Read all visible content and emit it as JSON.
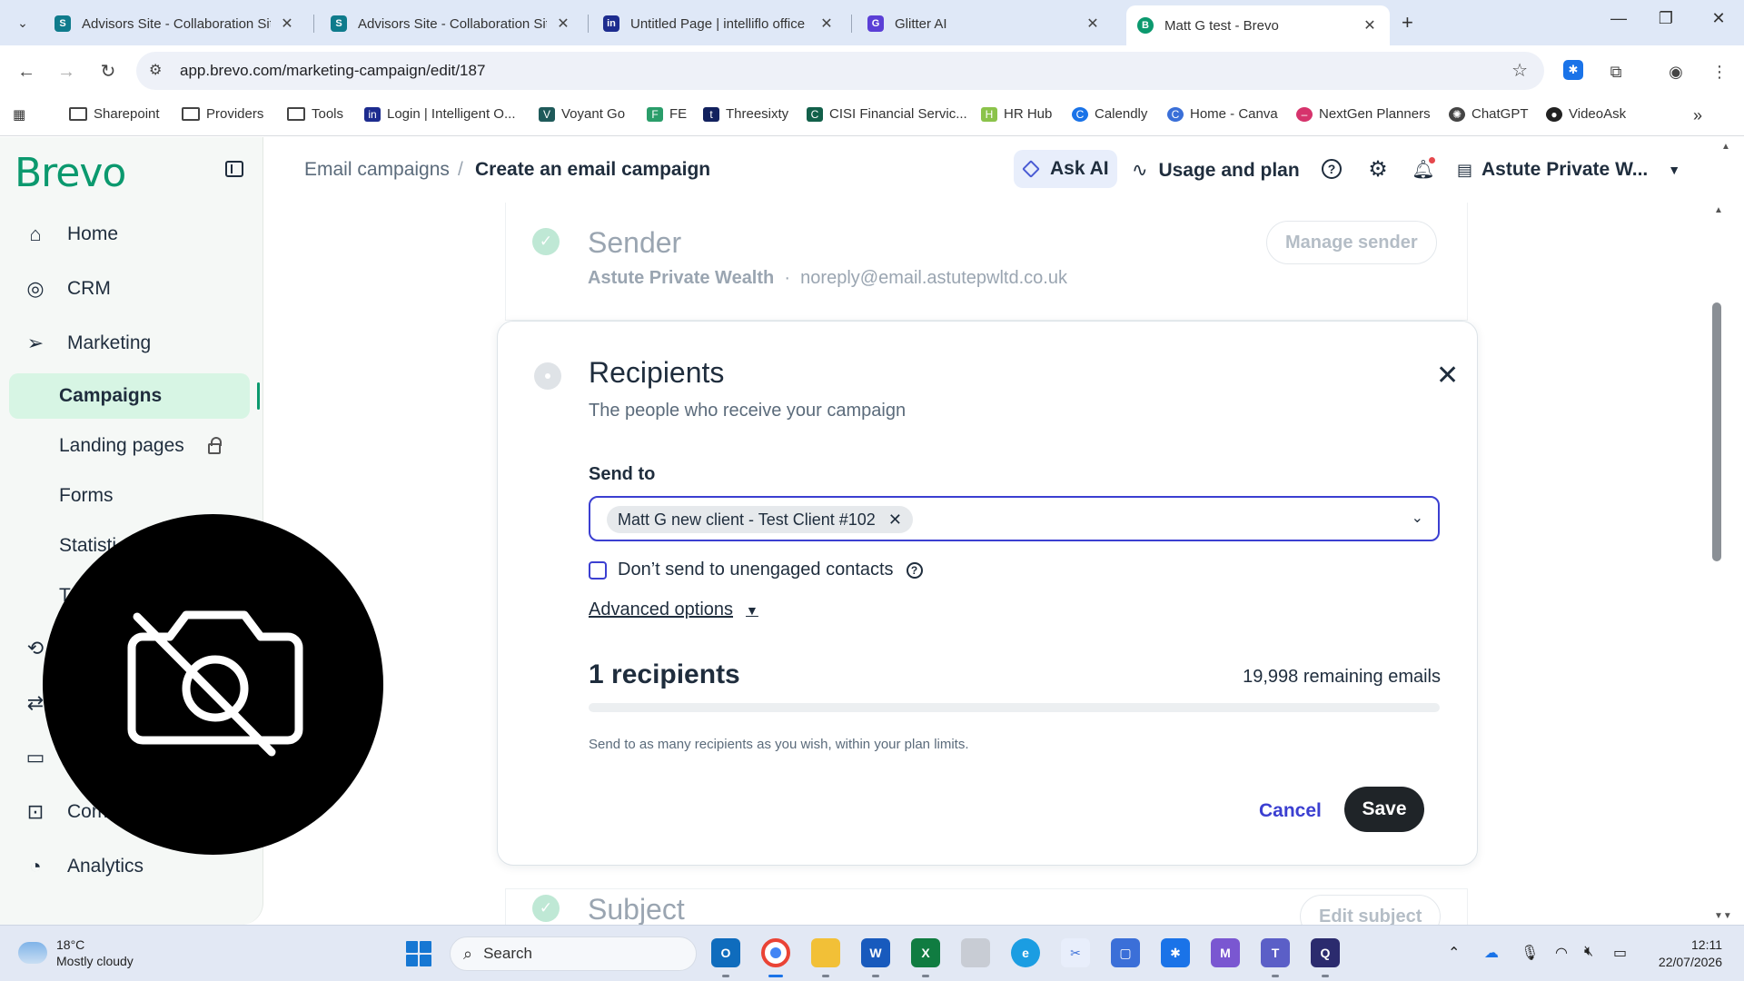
{
  "browser": {
    "tabs": [
      {
        "title": "Advisors Site - Collaboration Sit",
        "favicon": "sharepoint-icon"
      },
      {
        "title": "Advisors Site - Collaboration Sit",
        "favicon": "sharepoint-icon"
      },
      {
        "title": "Untitled Page | intelliflo office",
        "favicon": "intelliflo-icon"
      },
      {
        "title": "Glitter AI",
        "favicon": "glitter-icon"
      },
      {
        "title": "Matt G test - Brevo",
        "favicon": "brevo-icon",
        "active": true
      }
    ],
    "url": "app.brevo.com/marketing-campaign/edit/187",
    "bookmarks": [
      "Sharepoint",
      "Providers",
      "Tools",
      "Login | Intelligent O...",
      "Voyant Go",
      "FE",
      "Threesixty",
      "CISI Financial Servic...",
      "HR Hub",
      "Calendly",
      "Home - Canva",
      "NextGen Planners",
      "ChatGPT",
      "VideoAsk"
    ]
  },
  "app": {
    "logo": "Brevo",
    "nav": {
      "home": "Home",
      "crm": "CRM",
      "marketing": "Marketing",
      "campaigns": "Campaigns",
      "landing_pages": "Landing pages",
      "forms": "Forms",
      "statistics": "Statisti",
      "hidden_t": "T",
      "commerce": "Comm",
      "analytics": "Analytics"
    },
    "breadcrumb": {
      "parent": "Email campaigns",
      "separator": "/",
      "current": "Create an email campaign"
    },
    "header": {
      "ask_ai": "Ask AI",
      "usage": "Usage and plan",
      "account": "Astute Private W..."
    },
    "sender": {
      "title": "Sender",
      "name": "Astute Private Wealth",
      "dot": "·",
      "email": "noreply@email.astutepwltd.co.uk",
      "button": "Manage sender"
    },
    "recipients": {
      "title": "Recipients",
      "subtitle": "The people who receive your campaign",
      "send_to_label": "Send to",
      "selected_list": "Matt G new client - Test Client #102",
      "checkbox_label": "Don’t send to unengaged contacts",
      "checkbox_checked": false,
      "advanced": "Advanced options",
      "count": "1 recipients",
      "remaining": "19,998 remaining emails",
      "usage_fraction": 0.0,
      "hint": "Send to as many recipients as you wish, within your plan limits.",
      "cancel": "Cancel",
      "save": "Save"
    },
    "subject": {
      "title": "Subject",
      "button": "Edit subject"
    }
  },
  "taskbar": {
    "weather_temp": "18°C",
    "weather_desc": "Mostly cloudy",
    "search": "Search",
    "time": "12:11",
    "date": "22/07/2026"
  },
  "colors": {
    "brand": "#0b996e",
    "accent": "#3b3fd1",
    "active_nav": "#d7f5e4"
  }
}
